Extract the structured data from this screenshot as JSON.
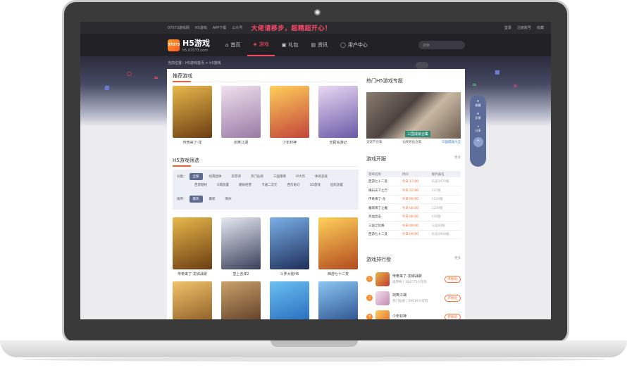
{
  "topbar": {
    "items": [
      "07073游戏网",
      "H5游戏",
      "APP下载",
      "公众号"
    ],
    "promo": "大佬请移步，超精超开心！",
    "login": "登录",
    "register": "注册账号",
    "favorite": "收藏"
  },
  "header": {
    "logo_title": "H5游戏",
    "logo_sub": "h5.07073.com",
    "logo_badge": "07073",
    "nav": [
      "首页",
      "游戏",
      "礼包",
      "资讯",
      "用户中心"
    ],
    "active_nav": "游戏",
    "search_placeholder": "搜索"
  },
  "breadcrumb": "当前位置：H5游戏首页 > h5游戏",
  "recommend": {
    "title": "推荐游戏",
    "games": [
      {
        "name": "传奇来了-龙",
        "color": "#b88a2a"
      },
      {
        "name": "剑笑江湖",
        "color": "#c9a9c2"
      },
      {
        "name": "少年封神",
        "color": "#d65a3a"
      },
      {
        "name": "全民仙游记",
        "color": "#8a7ac2"
      }
    ]
  },
  "filter": {
    "title": "H5游戏筛选",
    "category_label": "分类：",
    "categories_row1": [
      "全部",
      "经典团休",
      "奔荐诗",
      "热门仙侠",
      "三国策略",
      "IP大作",
      "休闲竞技"
    ],
    "categories_row2": [
      "西游题材",
      "Q萌放置",
      "模拟经营",
      "卡通二次元",
      "西方奇幻",
      "3D游戏",
      "挂机放置"
    ],
    "sort_label": "排序：",
    "sorts": [
      "最热",
      "最新",
      "简体"
    ]
  },
  "list_games": [
    {
      "name": "传奇来了-龙城战歌",
      "color": "#b08426"
    },
    {
      "name": "皇上吉祥2",
      "color": "#3a3f5a"
    },
    {
      "name": "斗罗大陆H5",
      "color": "#2b4e8c"
    },
    {
      "name": "西游七十二变",
      "color": "#d8702a"
    },
    {
      "name": "",
      "color": "#c48a2a"
    },
    {
      "name": "",
      "color": "#6a3e2a"
    },
    {
      "name": "",
      "color": "#2a82d0"
    },
    {
      "name": "",
      "color": "#2a5e9c"
    }
  ],
  "hot_topic": {
    "title": "热门H5游戏专题",
    "banner_text": "三国成就合集",
    "tabs": [
      "圣诞节合集",
      "仙侠修仙合集",
      "三国成就大全"
    ]
  },
  "servers": {
    "title": "游戏开服",
    "more": "更多",
    "headers": [
      "游戏名称",
      "时间",
      "服务器名"
    ],
    "rows": [
      {
        "game": "西游七十二变",
        "time": "今日 17:00",
        "server": "乐途2070服"
      },
      {
        "game": "横扫天下之万",
        "time": "今日 22:00",
        "server": "127服"
      },
      {
        "game": "传奇来了-龙",
        "time": "今日 00:00",
        "server": "1120服"
      },
      {
        "game": "魔域来了之魔",
        "time": "今日 00:00",
        "server": "1239服"
      },
      {
        "game": "热血合击",
        "time": "今日 08:00",
        "server": "456服"
      },
      {
        "game": "三国之玩舞",
        "time": "今日 09:00",
        "server": "三国30服"
      },
      {
        "game": "西游七十二变",
        "time": "今日 09:00",
        "server": "乐途2068服"
      }
    ]
  },
  "ranking": {
    "title": "游戏排行榜",
    "more": "更多",
    "items": [
      {
        "rank": "1",
        "name": "传奇来了-龙城战歌",
        "meta": "奥传奇 | 162775人在玩",
        "action": "开始玩",
        "color": "#c0392b"
      },
      {
        "rank": "2",
        "name": "剑笑江湖",
        "meta": "热门仙侠 | 20619人在玩",
        "action": "开始玩",
        "color": "#c48ab2"
      },
      {
        "rank": "3",
        "name": "少年封神",
        "meta": "",
        "action": "开始玩",
        "color": "#e06a3a"
      }
    ]
  },
  "float_bar": {
    "items": [
      "收藏",
      "反馈",
      "分享"
    ],
    "top": "^"
  }
}
